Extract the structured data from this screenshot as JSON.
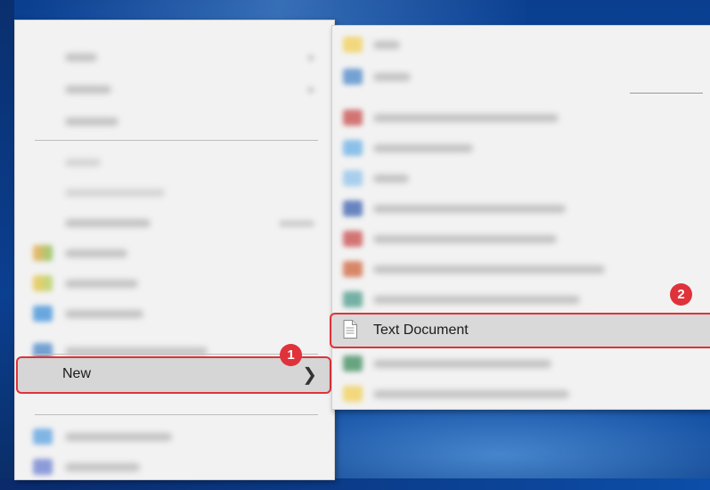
{
  "menu": {
    "new_item": {
      "label": "New"
    }
  },
  "submenu": {
    "text_document": {
      "label": "Text Document"
    }
  },
  "callouts": [
    {
      "number": "1"
    },
    {
      "number": "2"
    }
  ],
  "icons": {
    "submenu_arrow": "chevron-right-icon",
    "text_document": "text-document-icon"
  },
  "colors": {
    "callout_red": "#e0323a",
    "highlight": "#d6d6d6",
    "menu_bg": "#f2f2f2"
  }
}
